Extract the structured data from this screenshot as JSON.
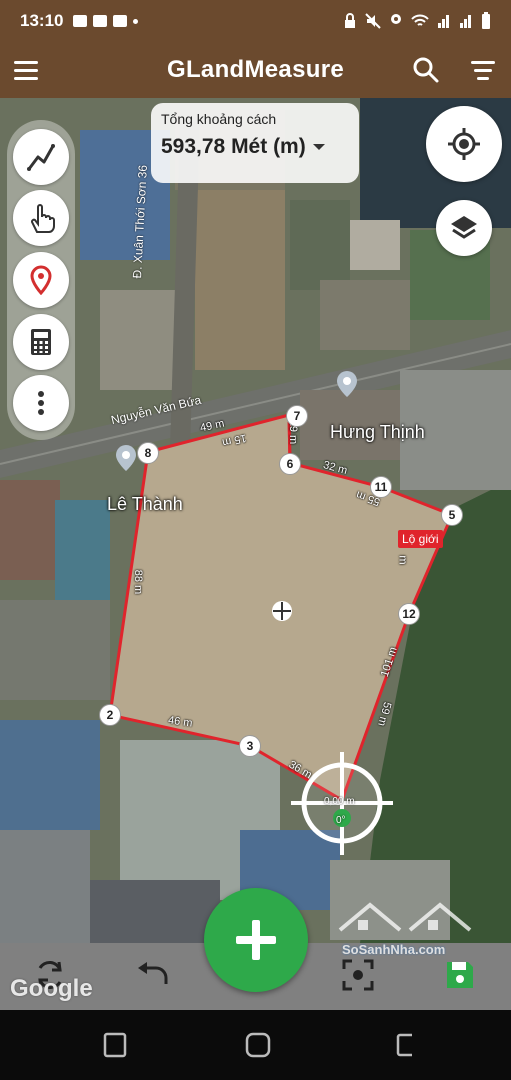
{
  "status_bar": {
    "time": "13:10"
  },
  "app_bar": {
    "title": "GLandMeasure"
  },
  "distance": {
    "caption": "Tổng khoảng cách",
    "value": "593,78 Mét (m)"
  },
  "map": {
    "places": {
      "hung_thinh": "Hưng Thịnh",
      "le_thanh": "Lê Thành",
      "lo_gioi": "Lộ giới"
    },
    "roads": {
      "nguyen_van_bua": "Nguyễn Văn Bứa",
      "xuan_thoi_son": "Đ. Xuân Thới Sơn 36"
    },
    "vertices": [
      "7",
      "8",
      "6",
      "11",
      "5",
      "12",
      "2",
      "3"
    ],
    "dimensions": {
      "d49": "49 m",
      "d15": "15 m",
      "d19": "19 m",
      "d32": "32 m",
      "d55": "55 m",
      "d88": "88 m",
      "d46": "46 m",
      "d36": "36 m",
      "d101": "101 m",
      "d59": "59 m",
      "dm": "m"
    },
    "crosshair": {
      "distance": "0,00 m",
      "angle": "0°"
    }
  },
  "footer": {
    "google": "Google",
    "watermark": "SoSanhNha.com"
  },
  "colors": {
    "app_bar": "#6b4a2e",
    "fab": "#2ea94a",
    "polygon": "#e0242c",
    "save": "#2ea94a"
  }
}
